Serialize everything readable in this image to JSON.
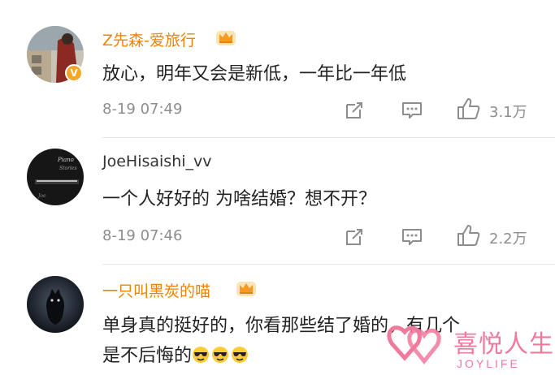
{
  "comments": [
    {
      "username": "Z先森-爱旅行",
      "text": "放心，明年又会是新低，一年比一年低",
      "time": "8-19 07:49",
      "likes": "3.1万"
    },
    {
      "username": "JoeHisaishi_vv",
      "text": "一个人好好的 为啥结婚？想不开？",
      "time": "8-19 07:46",
      "likes": "2.2万"
    },
    {
      "username": "一只叫黑炭的喵",
      "text_line1": "单身真的挺好的，你看那些结了婚的，有几个",
      "text_line2": "是不后悔的"
    }
  ],
  "watermark": {
    "brand": "喜悦人生",
    "sub": "JOYLIFE"
  },
  "colors": {
    "vip_name": "#f08300",
    "like_icon": "#8d8d8d",
    "watermark": "#f07a9c"
  }
}
